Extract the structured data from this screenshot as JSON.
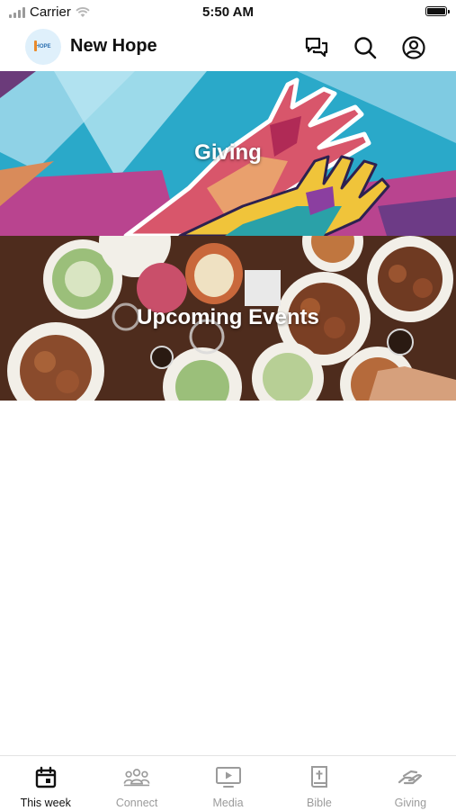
{
  "status_bar": {
    "carrier": "Carrier",
    "time": "5:50 AM"
  },
  "header": {
    "logo_text": "HOPE",
    "title": "New Hope",
    "icons": [
      "chat-icon",
      "search-icon",
      "profile-icon"
    ]
  },
  "banners": [
    {
      "label": "Giving"
    },
    {
      "label": "Upcoming Events"
    }
  ],
  "tabbar": {
    "active": "This week",
    "tabs": [
      {
        "label": "This week",
        "icon": "calendar-icon"
      },
      {
        "label": "Connect",
        "icon": "people-icon"
      },
      {
        "label": "Media",
        "icon": "play-screen-icon"
      },
      {
        "label": "Bible",
        "icon": "bible-icon"
      },
      {
        "label": "Giving",
        "icon": "hand-icon"
      }
    ]
  },
  "colors": {
    "active_tab": "#111111",
    "inactive_tab": "#9b9b9b",
    "giving_banner_base": "#2aa9c9",
    "events_banner_base": "#5a3422"
  }
}
